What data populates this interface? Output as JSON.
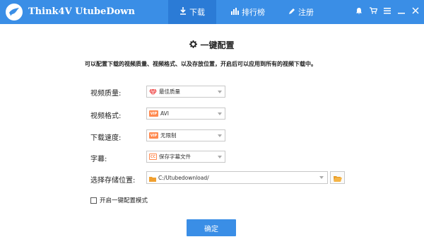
{
  "app": {
    "title": "Think4V  UtubeDown"
  },
  "nav": {
    "tabs": [
      {
        "label": "下载",
        "icon": "download-icon",
        "active": true
      },
      {
        "label": "排行榜",
        "icon": "bar-chart-icon",
        "active": false
      },
      {
        "label": "注册",
        "icon": "pencil-icon",
        "active": false
      }
    ]
  },
  "window_controls": [
    "bell-icon",
    "cart-icon",
    "menu-icon",
    "minimize-icon",
    "close-icon"
  ],
  "config": {
    "heading": "一键配置",
    "description": "可以配置下载的视频质量、视频格式、以及存放位置，开启后可以应用到所有的视频下载中。",
    "rows": [
      {
        "label": "视频质量:",
        "value": "最佳质量",
        "icon": "gem-icon"
      },
      {
        "label": "视频格式:",
        "value": "AVI",
        "icon": "vip-badge-icon",
        "badge": "VIP"
      },
      {
        "label": "下载速度:",
        "value": "无限制",
        "icon": "vip-badge-icon",
        "badge": "VIP"
      },
      {
        "label": "字幕:",
        "value": "保存字幕文件",
        "icon": "cc-icon",
        "badge": "CC"
      }
    ],
    "location": {
      "label": "选择存储位置:",
      "value": "C:/Utubedownload/",
      "icon": "folder-icon"
    },
    "checkbox_label": "开启一键配置模式",
    "checkbox_checked": false,
    "confirm_label": "确定"
  },
  "colors": {
    "brand": "#3a8ee6",
    "vip": "#ff8a50"
  }
}
